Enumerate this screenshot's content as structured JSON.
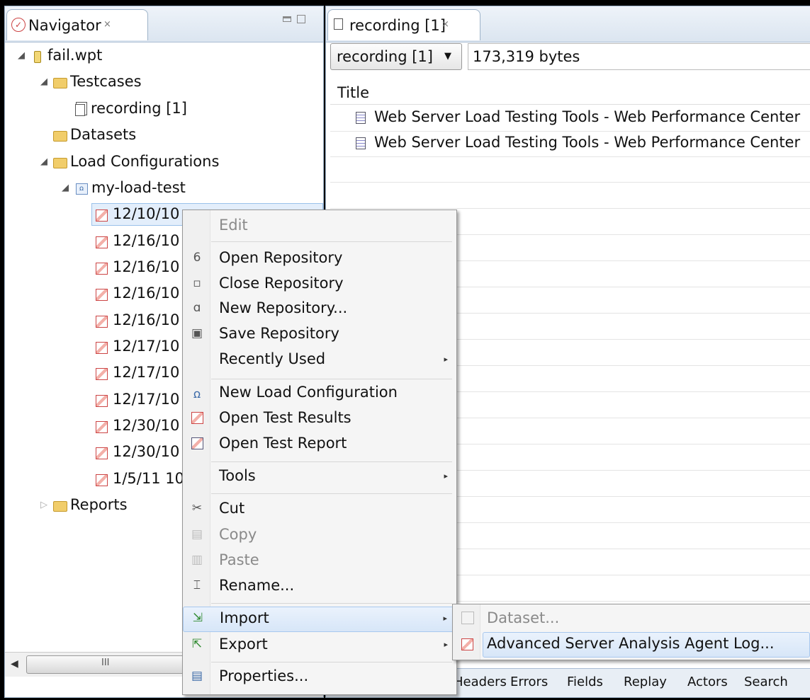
{
  "navigator": {
    "tab_label": "Navigator",
    "tab_close": "×",
    "tree": [
      {
        "label": "fail.wpt",
        "icon": "database-icon",
        "arrow": "◢"
      },
      {
        "label": "Testcases",
        "icon": "open-folder-icon",
        "arrow": "◢"
      },
      {
        "label": "recording [1]",
        "icon": "testcase-icon"
      },
      {
        "label": "Datasets",
        "icon": "folder-icon"
      },
      {
        "label": "Load Configurations",
        "icon": "open-folder-icon",
        "arrow": "◢"
      },
      {
        "label": "my-load-test",
        "icon": "load-config-icon",
        "arrow": "◢"
      },
      {
        "label": "12/10/10",
        "icon": "result-icon"
      },
      {
        "label": "12/16/10",
        "icon": "result-icon"
      },
      {
        "label": "12/16/10",
        "icon": "result-icon"
      },
      {
        "label": "12/16/10",
        "icon": "result-icon"
      },
      {
        "label": "12/16/10",
        "icon": "result-icon"
      },
      {
        "label": "12/17/10",
        "icon": "result-icon"
      },
      {
        "label": "12/17/10",
        "icon": "result-icon"
      },
      {
        "label": "12/17/10",
        "icon": "result-icon"
      },
      {
        "label": "12/30/10",
        "icon": "result-icon"
      },
      {
        "label": "12/30/10",
        "icon": "result-icon"
      },
      {
        "label": "1/5/11 10",
        "icon": "result-icon"
      },
      {
        "label": "Reports",
        "icon": "folder-icon",
        "arrow": "▷"
      }
    ],
    "scroll_grip": "III"
  },
  "editor": {
    "tab_label": "recording [1]",
    "tab_close": "×",
    "select_value": "recording [1]",
    "bytes": "173,319 bytes",
    "column_title": "Title",
    "rows": [
      "Web Server Load Testing Tools - Web Performance Center",
      "Web Server Load Testing Tools - Web Performance Center"
    ],
    "bottom_tabs": [
      "Headers",
      "Errors",
      "Fields",
      "Replay",
      "Actors",
      "Search"
    ]
  },
  "context_menu": {
    "items": [
      {
        "label": "Edit",
        "disabled": true
      },
      {
        "label": "Open Repository",
        "icon": "open-repository-icon"
      },
      {
        "label": "Close Repository",
        "icon": "close-repository-icon"
      },
      {
        "label": "New Repository...",
        "icon": "new-repository-icon"
      },
      {
        "label": "Save Repository",
        "icon": "save-icon"
      },
      {
        "label": "Recently Used",
        "submenu": true
      },
      {
        "label": "New Load Configuration",
        "icon": "load-config-icon"
      },
      {
        "label": "Open Test Results",
        "icon": "result-icon"
      },
      {
        "label": "Open Test Report",
        "icon": "report-icon"
      },
      {
        "label": "Tools",
        "submenu": true
      },
      {
        "label": "Cut",
        "icon": "scissors-icon"
      },
      {
        "label": "Copy",
        "icon": "copy-icon",
        "disabled": true
      },
      {
        "label": "Paste",
        "icon": "paste-icon",
        "disabled": true
      },
      {
        "label": "Rename...",
        "icon": "rename-icon"
      },
      {
        "label": "Import",
        "icon": "import-icon",
        "submenu": true,
        "highlighted": true
      },
      {
        "label": "Export",
        "icon": "export-icon",
        "submenu": true
      },
      {
        "label": "Properties...",
        "icon": "properties-icon"
      }
    ],
    "submenu_arrow": "▸"
  },
  "import_submenu": {
    "items": [
      {
        "label": "Dataset...",
        "disabled": true,
        "icon": "dataset-icon"
      },
      {
        "label": "Advanced Server Analysis Agent Log...",
        "icon": "result-icon",
        "highlighted": true
      }
    ]
  }
}
